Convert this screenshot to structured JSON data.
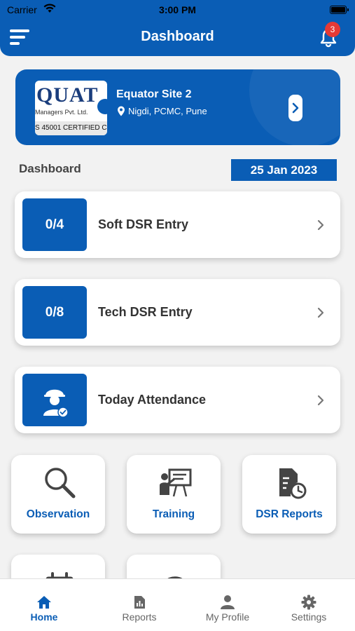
{
  "status_bar": {
    "carrier": "Carrier",
    "time": "3:00 PM"
  },
  "header": {
    "title": "Dashboard",
    "notification_count": "3"
  },
  "site": {
    "logo_text": "QUAT",
    "logo_subtext": "Managers Pvt. Ltd.",
    "logo_cert": "S 45001 CERTIFIED C",
    "name": "Equator Site 2",
    "location": "Nigdi, PCMC, Pune"
  },
  "dashboard": {
    "label": "Dashboard",
    "date": "25 Jan 2023"
  },
  "entries": [
    {
      "badge": "0/4",
      "label": "Soft DSR Entry"
    },
    {
      "badge": "0/8",
      "label": "Tech DSR Entry"
    },
    {
      "badge": "",
      "label": "Today Attendance"
    }
  ],
  "tiles": [
    {
      "label": "Observation",
      "icon": "magnifier-icon"
    },
    {
      "label": "Training",
      "icon": "training-board-icon"
    },
    {
      "label": "DSR Reports",
      "icon": "report-clock-icon"
    }
  ],
  "bottom_nav": [
    {
      "label": "Home",
      "icon": "home-icon",
      "active": true
    },
    {
      "label": "Reports",
      "icon": "reports-icon"
    },
    {
      "label": "My Profile",
      "icon": "profile-icon"
    },
    {
      "label": "Settings",
      "icon": "gear-icon"
    }
  ],
  "colors": {
    "primary": "#0a5db5",
    "badge_red": "#e53935",
    "background": "#f2f2f2"
  }
}
